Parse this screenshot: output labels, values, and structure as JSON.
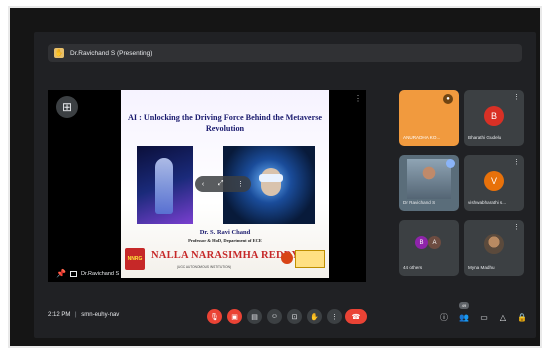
{
  "presenter_bar": {
    "text": "Dr.Ravichand S (Presenting)"
  },
  "stage": {
    "name_tag": "Dr.Ravichand S",
    "slide": {
      "title": "AI : Unlocking the Driving Force Behind the Metaverse Revolution",
      "author": "Dr. S. Ravi Chand",
      "designation": "Professor & HoD, Department of ECE",
      "college": "NALLA NARASIMHA REDDY",
      "left_logo": "NNRG",
      "status": "(UGC AUTONOMOUS INSTITUTION)"
    }
  },
  "participants": [
    {
      "label": "ANURADHA KO..."
    },
    {
      "initial": "B",
      "label": "Bharathi Gudelu",
      "color": "#d93025"
    },
    {
      "label": "Dr Ravichand S"
    },
    {
      "initial": "V",
      "label": "vishwabharathi s...",
      "color": "#e8710a"
    },
    {
      "label": "44 others",
      "avatar_initials": [
        "B",
        "A"
      ]
    },
    {
      "label": "Myna Madhu"
    }
  ],
  "bottom_bar": {
    "time": "2:12 PM",
    "separator": "|",
    "meeting_code": "smn-euhy-nav",
    "people_count": "49"
  }
}
